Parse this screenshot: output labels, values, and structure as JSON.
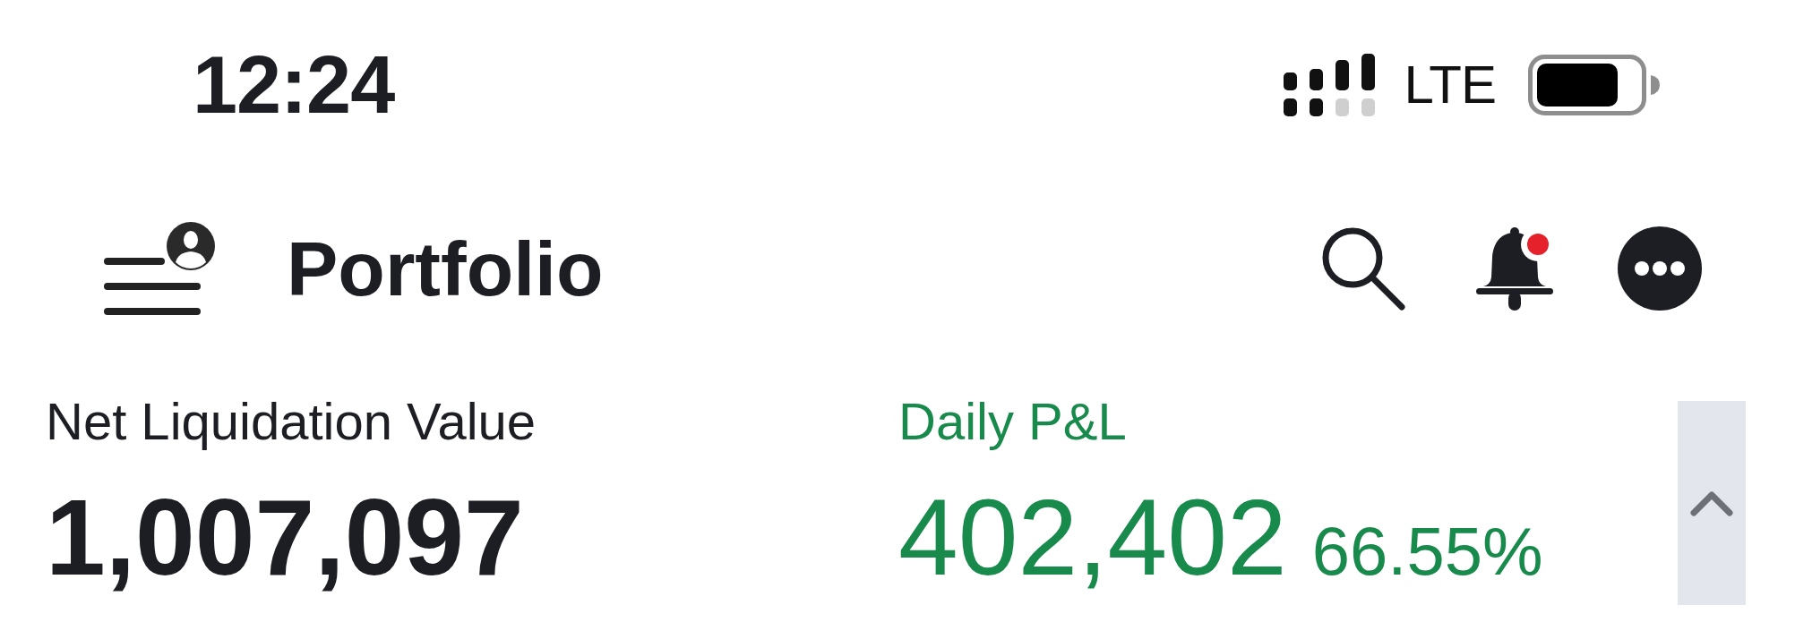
{
  "status_bar": {
    "time": "12:24",
    "network": "LTE"
  },
  "header": {
    "title": "Portfolio",
    "unread": true
  },
  "metrics": [
    {
      "label": "Net Liquidation Value",
      "value": "1,007,097",
      "kind": "neutral"
    },
    {
      "label": "Daily P&L",
      "value": "402,402",
      "change": "66.55%",
      "kind": "gain"
    }
  ],
  "collapse_toggle": {
    "expanded": true
  }
}
